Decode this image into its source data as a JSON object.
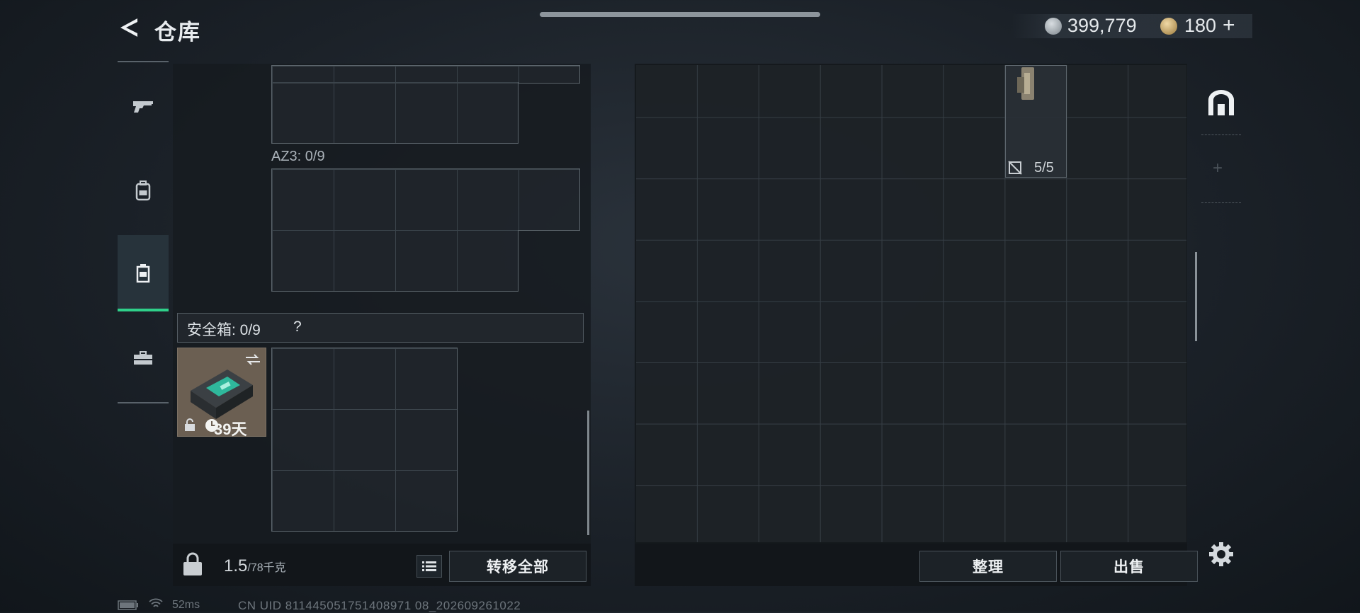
{
  "header": {
    "title": "仓库",
    "money": "399,779",
    "points": "180",
    "add_symbol": "+"
  },
  "nav": {
    "items": [
      {
        "icon": "pistol-icon"
      },
      {
        "icon": "backpack-icon"
      },
      {
        "icon": "container-icon",
        "active": true
      },
      {
        "icon": "toolbox-icon"
      }
    ]
  },
  "left_panel": {
    "az3_label": "AZ3: 0/9",
    "safe_box_label": "安全箱: 0/9",
    "help_symbol": "?",
    "item": {
      "duration": "39天",
      "icons": [
        "lock-icon",
        "clock-icon",
        "swap-icon"
      ]
    },
    "weight_value": "1.5",
    "weight_unit": "/78千克",
    "transfer_all_label": "转移全部"
  },
  "right_panel": {
    "slot_count": "5/5",
    "sort_label": "整理",
    "sell_label": "出售"
  },
  "status_bar": {
    "ping": "52ms",
    "uid": "CN UID 811445051751408971 08_202609261022"
  }
}
